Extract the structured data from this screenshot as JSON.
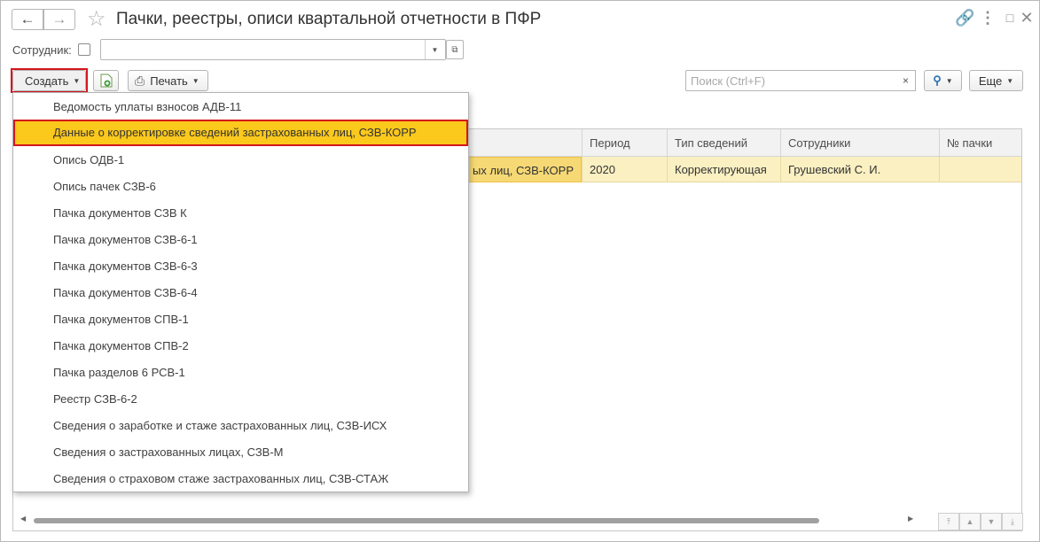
{
  "window": {
    "title": "Пачки, реестры, описи квартальной отчетности в ПФР"
  },
  "icons": {
    "back": "arrow-left-icon",
    "forward": "arrow-right-icon",
    "favorite": "star-icon",
    "link": "link-icon",
    "more": "more-icon",
    "restore": "restore-window-icon",
    "close": "close-icon"
  },
  "filter": {
    "employee_label": "Сотрудник:",
    "employee_value": ""
  },
  "toolbar": {
    "create_label": "Создать",
    "print_label": "Печать",
    "search_placeholder": "Поиск (Ctrl+F)",
    "more_label": "Еще"
  },
  "create_menu": {
    "items": [
      "Ведомость уплаты взносов АДВ-11",
      "Данные о корректировке сведений застрахованных лиц, СЗВ-КОРР",
      "Опись ОДВ-1",
      "Опись пачек СЗВ-6",
      "Пачка документов СЗВ К",
      "Пачка документов СЗВ-6-1",
      "Пачка документов СЗВ-6-3",
      "Пачка документов СЗВ-6-4",
      "Пачка документов СПВ-1",
      "Пачка документов СПВ-2",
      "Пачка разделов 6 РСВ-1",
      "Реестр СЗВ-6-2",
      "Сведения о заработке и стаже застрахованных лиц, СЗВ-ИСХ",
      "Сведения о застрахованных лицах, СЗВ-М",
      "Сведения о страховом стаже застрахованных лиц, СЗВ-СТАЖ"
    ],
    "selected_index": 1
  },
  "table": {
    "columns": [
      "Период",
      "Тип сведений",
      "Сотрудники",
      "№ пачки"
    ],
    "rows": [
      {
        "document_tail": "ых лиц, СЗВ-КОРР",
        "period": "2020",
        "type": "Корректирующая",
        "employees": "Грушевский С. И.",
        "pack_no": ""
      }
    ]
  },
  "colors": {
    "highlight_border": "#d4161c",
    "selected_menu_bg": "#fbc81c",
    "selected_row_bg": "#fbf0c2"
  }
}
